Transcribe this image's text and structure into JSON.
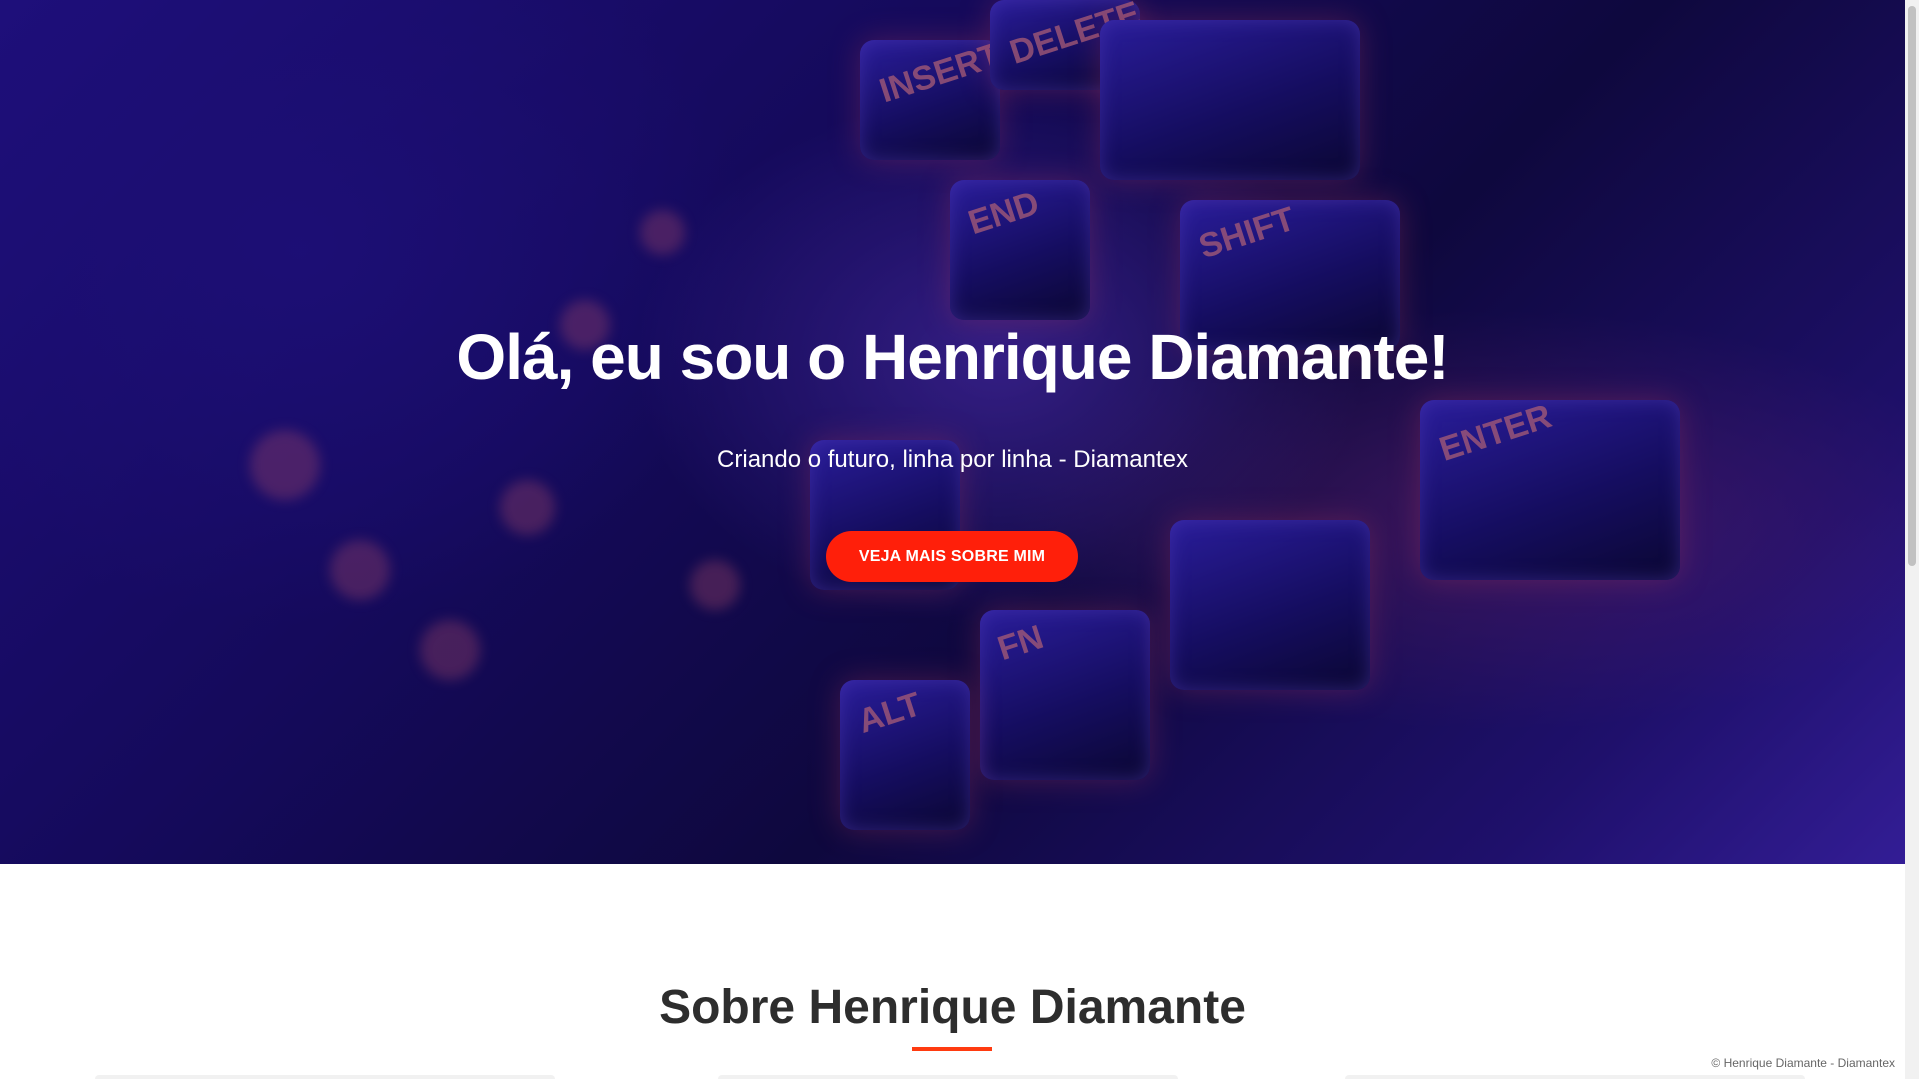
{
  "hero": {
    "title": "Olá, eu sou o Henrique Diamante!",
    "subtitle": "Criando o futuro, linha por linha - Diamantex",
    "button_label": "VEJA MAIS SOBRE MIM",
    "button_color": "#ff1f0a",
    "background_description_colors": [
      "#2a14a8",
      "#120a4a",
      "#ff6e8c"
    ],
    "key_labels": [
      "INSERT",
      "DELETE",
      "END",
      "SHIFT",
      "FN",
      "ALT",
      "ENTER"
    ]
  },
  "about": {
    "heading": "Sobre Henrique Diamante",
    "accent_color": "#ff3b10"
  },
  "footer": {
    "copyright": "© Henrique Diamante - Diamantex"
  }
}
